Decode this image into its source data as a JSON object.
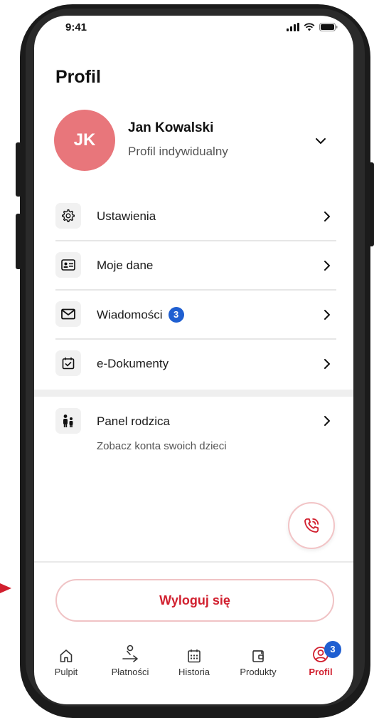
{
  "status_bar": {
    "time": "9:41"
  },
  "page": {
    "title": "Profil"
  },
  "profile": {
    "initials": "JK",
    "name": "Jan Kowalski",
    "type": "Profil indywidualny",
    "avatar_color": "#e8767b"
  },
  "menu": {
    "items": [
      {
        "label": "Ustawienia",
        "icon": "gear-icon"
      },
      {
        "label": "Moje dane",
        "icon": "id-card-icon"
      },
      {
        "label": "Wiadomości",
        "icon": "envelope-icon",
        "badge": "3"
      },
      {
        "label": "e-Dokumenty",
        "icon": "calendar-check-icon"
      }
    ]
  },
  "parent_panel": {
    "label": "Panel rodzica",
    "subtitle": "Zobacz konta swoich dzieci",
    "icon": "family-icon"
  },
  "fab": {
    "icon": "phone-icon"
  },
  "logout": {
    "label": "Wyloguj się"
  },
  "tabbar": {
    "tabs": [
      {
        "label": "Pulpit",
        "icon": "home-icon"
      },
      {
        "label": "Płatności",
        "icon": "transfer-icon"
      },
      {
        "label": "Historia",
        "icon": "calendar-grid-icon"
      },
      {
        "label": "Produkty",
        "icon": "wallet-icon"
      },
      {
        "label": "Profil",
        "icon": "user-circle-icon",
        "badge": "3",
        "active": true
      }
    ]
  },
  "colors": {
    "accent_red": "#d11f2e",
    "badge_blue": "#1f5fd1",
    "frame": "#1b1b1b"
  }
}
